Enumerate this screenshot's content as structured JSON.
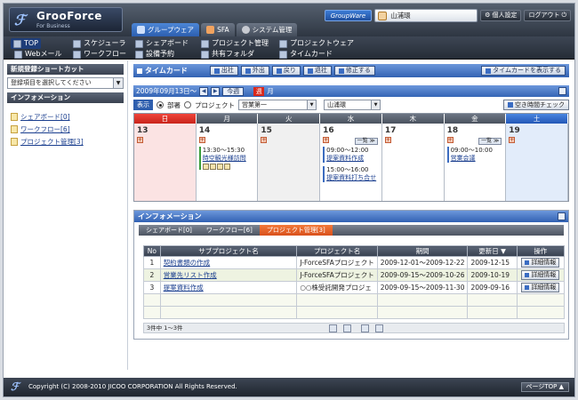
{
  "app": {
    "logo_name": "GrooForce",
    "logo_sub": "For Business",
    "top_tabs": [
      {
        "label": "グループウェア",
        "color": "#3d7ad0"
      },
      {
        "label": "SFA",
        "color": "#e07a2e"
      },
      {
        "label": "システム管理",
        "color": "#8c8f99"
      }
    ],
    "groupware_btn": "GroupWare",
    "user_name": "山浦環",
    "personal_settings": "個人設定",
    "logout": "ログアウト"
  },
  "menu": {
    "items": [
      {
        "label": "TOP"
      },
      {
        "label": "スケジューラ"
      },
      {
        "label": "シェアボード"
      },
      {
        "label": "プロジェクト管理"
      },
      {
        "label": "プロジェクトウェア"
      },
      {
        "label": "Webメール"
      },
      {
        "label": "ワークフロー"
      },
      {
        "label": "設備予約"
      },
      {
        "label": "共有フォルダ"
      },
      {
        "label": "タイムカード"
      }
    ]
  },
  "sidebar": {
    "shortcut_title": "新規登録ショートカット",
    "shortcut_placeholder": "登録項目を選択してください",
    "info_title": "インフォメーション",
    "links": [
      "シェアボード[0]",
      "ワークフロー[6]",
      "プロジェクト管理[3]"
    ]
  },
  "timecard": {
    "title": "タイムカード",
    "buttons": [
      "出社",
      "外出",
      "戻り",
      "退社",
      "修正する"
    ],
    "show_button": "タイムカードを表示する"
  },
  "schedule": {
    "date_label": "2009年09月13日～",
    "today": "今週",
    "week_tag": "週",
    "month": "月",
    "display_label": "表示",
    "radio_dept": "部署",
    "radio_project": "プロジェクト",
    "dept_value": "営業第一",
    "user_value": "山浦環",
    "free_time_btn": "空き時間チェック",
    "days": [
      {
        "head": "日",
        "num": "13"
      },
      {
        "head": "月",
        "num": "14"
      },
      {
        "head": "火",
        "num": "15"
      },
      {
        "head": "水",
        "num": "16"
      },
      {
        "head": "木",
        "num": "17"
      },
      {
        "head": "金",
        "num": "18"
      },
      {
        "head": "土",
        "num": "19"
      }
    ],
    "list_label": "一覧",
    "events": {
      "mon_time": "13:30～15:30",
      "mon_title": "時空観光様訪問",
      "wed1_time": "09:00～12:00",
      "wed1_title": "提案資料作成",
      "wed2_time": "15:00～16:00",
      "wed2_title": "提案資料打ち合せ",
      "fri_time": "09:00～10:00",
      "fri_title": "営業会議"
    }
  },
  "info": {
    "title": "インフォメーション",
    "tabs": [
      "シェアボード[0]",
      "ワークフロー[6]",
      "プロジェクト管理[3]"
    ],
    "columns": [
      "No",
      "サブプロジェクト名",
      "プロジェクト名",
      "期間",
      "更新日 ▼",
      "操作"
    ],
    "rows": [
      {
        "no": "1",
        "sub": "契約書類の作成",
        "project": "J-ForceSFAプロジェクト",
        "period": "2009-12-01～2009-12-22",
        "updated": "2009-12-15",
        "action": "詳細情報"
      },
      {
        "no": "2",
        "sub": "営業先リスト作成",
        "project": "J-ForceSFAプロジェクト",
        "period": "2009-09-15～2009-10-26",
        "updated": "2009-10-19",
        "action": "詳細情報"
      },
      {
        "no": "3",
        "sub": "提案資料作成",
        "project": "○○株受託開発プロジェ",
        "period": "2009-09-15～2009-11-30",
        "updated": "2009-09-16",
        "action": "詳細情報"
      }
    ],
    "pager_text": "3件中 1～3件"
  },
  "footer": {
    "copyright": "Copyright (C) 2008-2010 JICOO CORPORATION All Rights Reserved.",
    "page_top": "ページTOP ▲"
  }
}
